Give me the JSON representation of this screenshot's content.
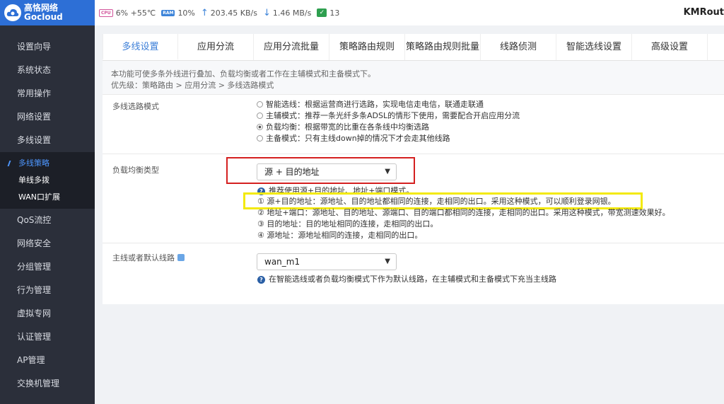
{
  "logo": {
    "cn": "高恪网络",
    "en": "Gocloud"
  },
  "top": {
    "cpu_chip": "CPU",
    "cpu": "6% +55℃",
    "ram_chip": "RAM",
    "ram": "10%",
    "up": "203.45 KB/s",
    "down": "1.46 MB/s",
    "conn": "13",
    "brand": "KMRout"
  },
  "nav": {
    "items": [
      "设置向导",
      "系统状态",
      "常用操作",
      "网络设置",
      "多线设置"
    ],
    "sub": [
      "多线策略",
      "单线多拨",
      "WAN口扩展"
    ],
    "items2": [
      "QoS流控",
      "网络安全",
      "分组管理",
      "行为管理",
      "虚拟专网",
      "认证管理",
      "AP管理",
      "交换机管理"
    ]
  },
  "tabs": [
    "多线设置",
    "应用分流",
    "应用分流批量",
    "策略路由规则",
    "策略路由规则批量",
    "线路侦测",
    "智能选线设置",
    "高级设置"
  ],
  "desc": {
    "line1": "本功能可使多条外线进行叠加、负载均衡或者工作在主辅模式和主备模式下。",
    "line2": "优先级：策略路由 > 应用分流 > 多线选路模式"
  },
  "mode": {
    "label": "多线选路模式",
    "options": [
      "智能选线：根据运营商进行选路，实现电信走电信，联通走联通",
      "主辅模式：推荐一条光纤多条ADSL的情形下使用，需要配合开启应用分流",
      "负载均衡：根据带宽的比重在各条线中均衡选路",
      "主备模式：只有主线down掉的情况下才会走其他线路"
    ],
    "selected_index": 2
  },
  "lb": {
    "label": "负载均衡类型",
    "value": "源 + 目的地址",
    "hint": "推荐使用源+目的地址、地址+端口模式。",
    "notes": [
      "① 源+目的地址：源地址、目的地址都相同的连接，走相同的出口。采用这种模式，可以顺利登录网银。",
      "② 地址+端口：源地址、目的地址、源端口、目的端口都相同的连接，走相同的出口。采用这种模式，带宽测速效果好。",
      "③ 目的地址：目的地址相同的连接，走相同的出口。",
      "④ 源地址：源地址相同的连接，走相同的出口。"
    ]
  },
  "default_line": {
    "label": "主线或者默认线路",
    "value": "wan_m1",
    "hint": "在智能选线或者负载均衡模式下作为默认线路，在主辅模式和主备模式下充当主线路"
  }
}
